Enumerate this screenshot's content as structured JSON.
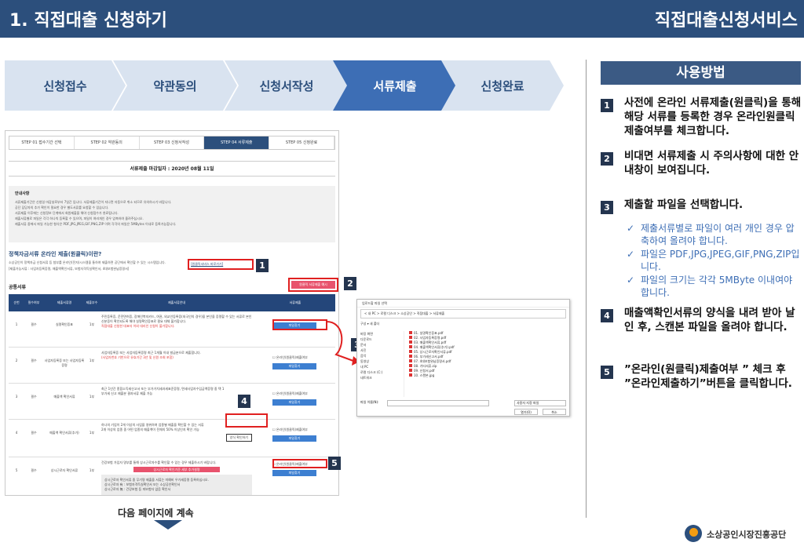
{
  "header": {
    "title": "1. 직접대출 신청하기",
    "service": "직접대출신청서비스"
  },
  "steps": [
    "신청접수",
    "약관동의",
    "신청서작성",
    "서류제출",
    "신청완료"
  ],
  "screenshot": {
    "tabs": [
      "STEP 01 접수기간 선택",
      "STEP 02 약관동의",
      "STEP 03 신청서작성",
      "STEP 04 서류제출",
      "STEP 05 신청완료"
    ],
    "deadline": "서류제출 마감일자 : 2020년 08월 11일",
    "notice_title": "안내사항",
    "notice_lines": [
      "서류제출기간은 신청일 마감날로부터 7일간 입니다. 서류제출기간이 지나면 자동으로 취소 되므로 유의하시기 바랍니다.",
      "공단 담당자의 추가 확인이 필요한 경우 별도서류를 요청할 수 있습니다.",
      "서류제출 이후에는 신청정보 단계에서 회원제출을 해야 신청접수가 완료됩니다.",
      "제출서류별로 파일은 각각 하나씩 등록할 수 있으며, 파일이 여러개인 경우 압축하여 올려주십시오.",
      "제출서류 중에서 파일 가능한 형식은 PDF,JPG,JPEG,GIF,PNG,ZIP 이며 각각의 파일은 5MBytes 이내로 등록가능합니다."
    ],
    "section_title": "정책자금서류 온라인 제출(원클릭)이란?",
    "section_desc": "소상공인이 정책자금 신청서류 등 첨부를 온라인(전자)시스템을 통하여 제출하면 공단에서 확인할 수 있는 시스템입니다.",
    "section_desc2": "[제출가능서류 : 사업자등록증명, 매출액확인서류, 보험자격득실확인서, 4대보험완납증명서]",
    "service_link": "[원클릭서비스 바로가기]",
    "common_label": "공통서류",
    "pink_button": "원클릭 서류제출 예시",
    "table_headers": [
      "순번",
      "필수여부",
      "제출서류명",
      "제출부수",
      "제출서류안내",
      "서류제출"
    ],
    "rows": [
      {
        "no": "1",
        "req": "필수",
        "name": "실명확인증표",
        "cnt": "1부",
        "desc": "주민등록증, 운전면허증, 장애인복지카드, 여권, 외교인등록증(외국인의 경우)을 본인을 증명할 수 있는 서류로 본인 신분증이 확인되도록 해야 실명확인증표로 필요 대체 불가합니다.",
        "desc2": "직접대출 신청한 대표자 이외 대리인 신청이 불가합니다.",
        "btn": "파일찾기"
      },
      {
        "no": "2",
        "req": "필수",
        "name": "사업자등록증 또는 사업자등록증명",
        "cnt": "1부",
        "desc": "사업자등록증 또는 사업자등록증명 최근 1개월 이내 발급분으로 제출합니다.",
        "desc2": "(사업자번호 기반으로 유효기간 3년 및 신원 조회 포함)",
        "chk": "온라인(원클릭)제출여부",
        "btn": "파일찾기"
      },
      {
        "no": "3",
        "req": "필수",
        "name": "매출액 확인서류",
        "cnt": "1부",
        "desc": "최근 1년간 종합소득세신고서 또는 부가가치세과세표준증명, 면세사업자수입금액증명 중 택 1",
        "desc2": "부가세 신고 제출분 결과서류 제출 가능",
        "chk": "온라인(원클릭)제출여부",
        "btn": "파일찾기"
      },
      {
        "no": "4",
        "req": "필수",
        "name": "매출액 확인서류(추가)",
        "cnt": "1부",
        "desc": "하나의 기업이 2개 이상의 사업을 영위하여 업종별 매출을 확인할 수 있는 서류",
        "desc2": "2개 이상의 업종 중 어떤 업종의 매출액이 전체의 50% 이상인지 확인 가능",
        "dark_btn": "양식 확인하기",
        "chk": "온라인(원클릭)제출여부",
        "btn": "파일찾기"
      },
      {
        "no": "5",
        "req": "필수",
        "name": "상시근로자 확인서류",
        "cnt": "1부",
        "desc": "건강보험 가입자 명부를 통해 상시근로자수를 확인할 수 있는 경우 제출하시기 바랍니다.",
        "pinkbar": "상시근로자 확인기준 세부 추가설명",
        "box1": "상시근로자 확인서류 중 무기명 제출을 서류는 미예비 우가세증명 등록하십시오.",
        "box2": "상시근로자 有 : 보험자격득실확인서 또는 소상공인확인서",
        "box3": "상시근로자 無 : 건강보험 등 피보험자 없음 확인서",
        "chk": "온라인(원클릭)제출여부",
        "btn": "파일찾기"
      }
    ]
  },
  "dialog": {
    "title": "업로드할 파일 선택",
    "path": "< 내 PC > 로컬 디스크 > 소상공인 > 직접대출 > 서류제출",
    "toolbar": "구성 ▾   새 폴더",
    "sidebar": [
      "바탕 화면",
      "다운로드",
      "문서",
      "사진",
      "음악",
      "동영상",
      "내 PC",
      "로컬 디스크 (C:)",
      "네트워크"
    ],
    "files": [
      "01. 실명확인증표.pdf",
      "02. 사업자등록증명.pdf",
      "03. 매출액확인서류.pdf",
      "04. 매출액확인서류(추가).pdf",
      "05. 상시근로자확인서류.pdf",
      "06. 부가세신고서.pdf",
      "07. 4대보험완납증명서.pdf",
      "08. 기타서류.zip",
      "09. 신청서.pdf",
      "10. 스캔본.jpg"
    ],
    "filename_label": "파일 이름(N):",
    "filetype": "사용자 지정 파일",
    "open": "열기(O)",
    "cancel": "취소"
  },
  "badges": [
    "1",
    "2",
    "3",
    "4",
    "5"
  ],
  "next_label": "다음 페이지에 계속",
  "usage_title": "사용방법",
  "items": [
    {
      "num": "1",
      "text": "사전에 온라인 서류제출(원클릭)을 통해 해당 서류를 등록한 경우 온라인원클릭제출여부를 체크합니다."
    },
    {
      "num": "2",
      "text": "비대면 서류제출 시 주의사항에 대한 안내창이 보여집니다."
    },
    {
      "num": "3",
      "text": "제출할 파일을 선택합니다."
    },
    {
      "num": "4",
      "text": "매출액확인서류의 양식을 내려 받아 날인 후, 스캔본 파일을 올려야 합니다."
    },
    {
      "num": "5",
      "text": "”온라인(원클릭)제출여부 ” 체크 후 ”온라인제출하기”버튼을 클릭합니다."
    }
  ],
  "bullets": [
    "제출서류별로 파일이 여러 개인 경우 압축하여 올려야 합니다.",
    "파일은 PDF,JPG,JPEG,GIF,PNG,ZIP입니다.",
    "파일의 크기는 각각 5MByte 이내여야 합니다."
  ],
  "footer": {
    "org": "소상공인시장진흥공단"
  },
  "colors": {
    "header": "#2c4f7c",
    "step": "#d9e3f0",
    "step_active": "#3d6eb5",
    "badge": "#24354f",
    "highlight": "#e02020",
    "bullet": "#3d6eb5"
  }
}
